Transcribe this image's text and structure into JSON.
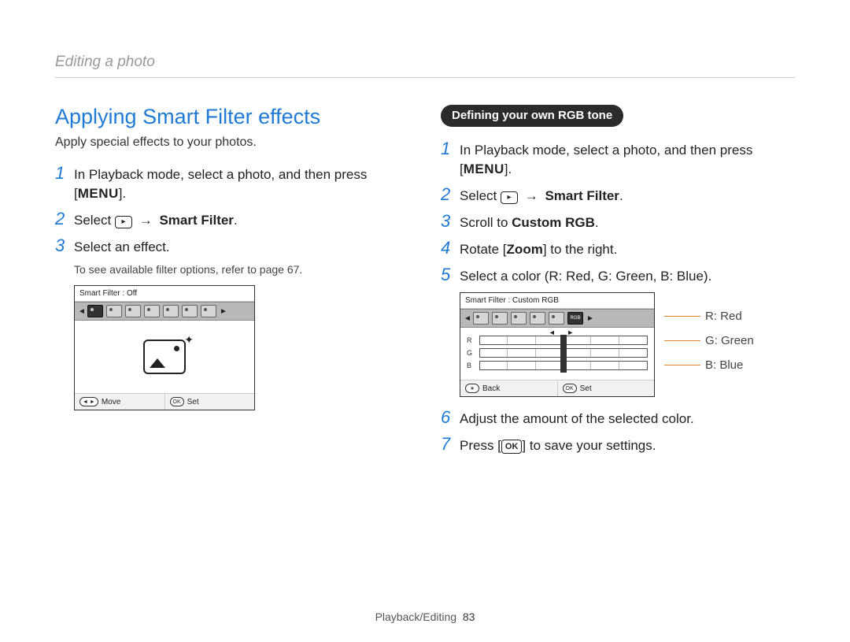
{
  "header": {
    "title": "Editing a photo"
  },
  "left": {
    "heading": "Applying Smart Filter effects",
    "intro": "Apply special effects to your photos.",
    "steps": {
      "s1_a": "In Playback mode, select a photo, and then press ",
      "s1_menu": "MENU",
      "s2_a": "Select ",
      "s2_b": "Smart Filter",
      "s3": "Select an effect."
    },
    "note": "To see available filter options, refer to page 67.",
    "screen": {
      "title": "Smart Filter  :  Off",
      "foot_left": "Move",
      "foot_right": "Set",
      "foot_left_key": "◄ ►",
      "foot_right_key": "OK"
    }
  },
  "right": {
    "pill": "Defining your own RGB tone",
    "steps": {
      "s1_a": "In Playback mode, select a photo, and then press ",
      "s1_menu": "MENU",
      "s2_a": "Select ",
      "s2_b": "Smart Filter",
      "s3_a": "Scroll to ",
      "s3_b": "Custom RGB",
      "s4_a": "Rotate [",
      "s4_b": "Zoom",
      "s4_c": "] to the right.",
      "s5": "Select a color (R: Red, G: Green, B: Blue).",
      "s6": "Adjust the amount of the selected color.",
      "s7_a": "Press [",
      "s7_b": "OK",
      "s7_c": "] to save your settings."
    },
    "screen": {
      "title": "Smart Filter : Custom RGB",
      "rows": {
        "r": "R",
        "g": "G",
        "b": "B"
      },
      "foot_left": "Back",
      "foot_right": "Set",
      "foot_left_key": "∗",
      "foot_right_key": "OK"
    },
    "callouts": {
      "r": "R: Red",
      "g": "G: Green",
      "b": "B: Blue"
    }
  },
  "footer": {
    "section": "Playback/Editing",
    "page": "83"
  }
}
